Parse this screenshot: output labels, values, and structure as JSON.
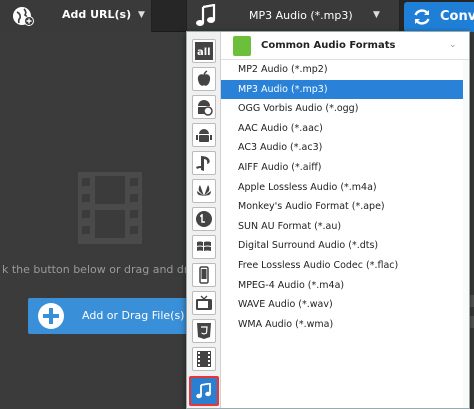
{
  "toolbar": {
    "add_url_label": "Add URL(s)",
    "format_label": "MP3 Audio (*.mp3)",
    "convert_label": "Conve",
    "caret": "▼"
  },
  "workspace": {
    "hint": "k the button below or drag and drop to",
    "add_file_label": "Add or Drag File(s)"
  },
  "dropdown": {
    "header": "Common Audio Formats",
    "header_caret": "⌄",
    "selected_index": 1,
    "items": [
      "MP2 Audio (*.mp2)",
      "MP3 Audio (*.mp3)",
      "OGG Vorbis Audio (*.ogg)",
      "AAC Audio (*.aac)",
      "AC3 Audio (*.ac3)",
      "AIFF Audio (*.aiff)",
      "Apple Lossless Audio (*.m4a)",
      "Monkey's Audio Format (*.ape)",
      "SUN AU Format (*.au)",
      "Digital Surround Audio (*.dts)",
      "Free Lossless Audio Codec (*.flac)",
      "MPEG-4 Audio (*.m4a)",
      "WAVE Audio (*.wav)",
      "WMA Audio (*.wma)"
    ],
    "categories": [
      {
        "icon": "all-formats-icon",
        "label": "all"
      },
      {
        "icon": "apple-icon"
      },
      {
        "icon": "android-tablet-icon"
      },
      {
        "icon": "android-icon"
      },
      {
        "icon": "playstation-icon"
      },
      {
        "icon": "huawei-icon"
      },
      {
        "icon": "lg-icon"
      },
      {
        "icon": "windows-icon"
      },
      {
        "icon": "phone-icon"
      },
      {
        "icon": "tv-icon"
      },
      {
        "icon": "html5-icon"
      },
      {
        "icon": "video-film-icon"
      },
      {
        "icon": "music-note-icon"
      }
    ]
  },
  "colors": {
    "accent": "#2a82d8",
    "toolbar_bg": "#262626",
    "workspace_bg": "#3b3b3b",
    "highlight_border": "#e33333",
    "header_icon": "#6cbf3b"
  }
}
